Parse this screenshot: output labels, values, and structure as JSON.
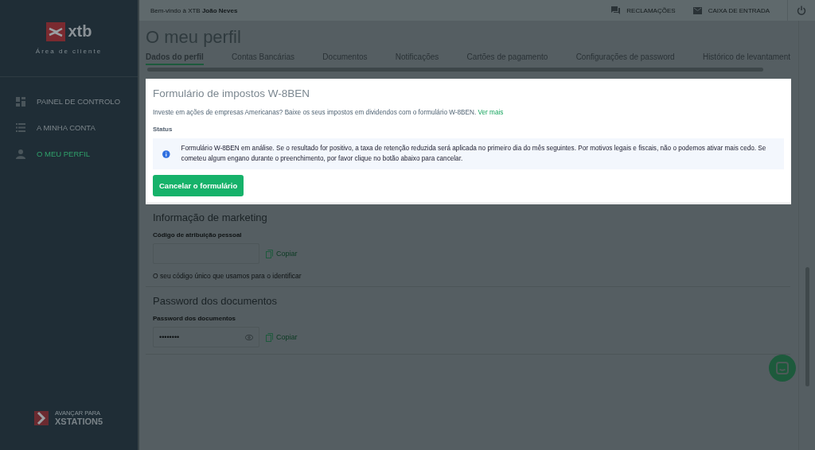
{
  "sidebar": {
    "logo_text": "xtb",
    "subtitle": "Área de cliente",
    "items": [
      {
        "label": "PAINEL DE CONTROLO",
        "selected": false
      },
      {
        "label": "A MINHA CONTA",
        "selected": false
      },
      {
        "label": "O MEU PERFIL",
        "selected": true
      }
    ],
    "promo": {
      "caption": "AVANÇAR PARA",
      "title": "XSTATION5"
    }
  },
  "topbar": {
    "welcome": "Bem-vindo à XTB **João Neves**",
    "actions": [
      {
        "label": "RECLAMAÇÕES"
      },
      {
        "label": "CAIXA DE ENTRADA"
      }
    ]
  },
  "page_title": "O meu perfil",
  "tabs": [
    {
      "label": "Dados do perfil",
      "selected": true
    },
    {
      "label": "Contas Bancárias",
      "selected": false
    },
    {
      "label": "Documentos",
      "selected": false
    },
    {
      "label": "Notificações",
      "selected": false
    },
    {
      "label": "Cartões de pagamento",
      "selected": false
    },
    {
      "label": "Configurações de password",
      "selected": false
    },
    {
      "label": "Histórico de levantament",
      "selected": false
    }
  ],
  "w8ben": {
    "title": "Formulário de impostos W-8BEN",
    "intro": "Investe em ações de empresas Americanas? Baixe os seus impostos em dividendos com o formulário W-8BEN.",
    "link": "Ver mais",
    "status_label": "Status",
    "notice": "Formulário W-8BEN em análise. Se o resultado for positivo, a taxa de retenção reduzida será aplicada no primeiro dia do mês seguintes. Por motivos legais e fiscais, não o podemos ativar mais cedo. Se cometeu algum engano durante o preenchimento, por favor clique no botão abaixo para cancelar.",
    "button": "Cancelar o formulário"
  },
  "sections": [
    {
      "title": "Informação de marketing",
      "field_label": "Código de atribuição pessoal",
      "secret": false,
      "copy": "Copiar",
      "hint": "O seu código único que usamos para o identificar"
    },
    {
      "title": "Password dos documentos",
      "field_label": "Password dos documentos",
      "value": "••••••••",
      "secret": true,
      "copy": "Copiar"
    }
  ]
}
